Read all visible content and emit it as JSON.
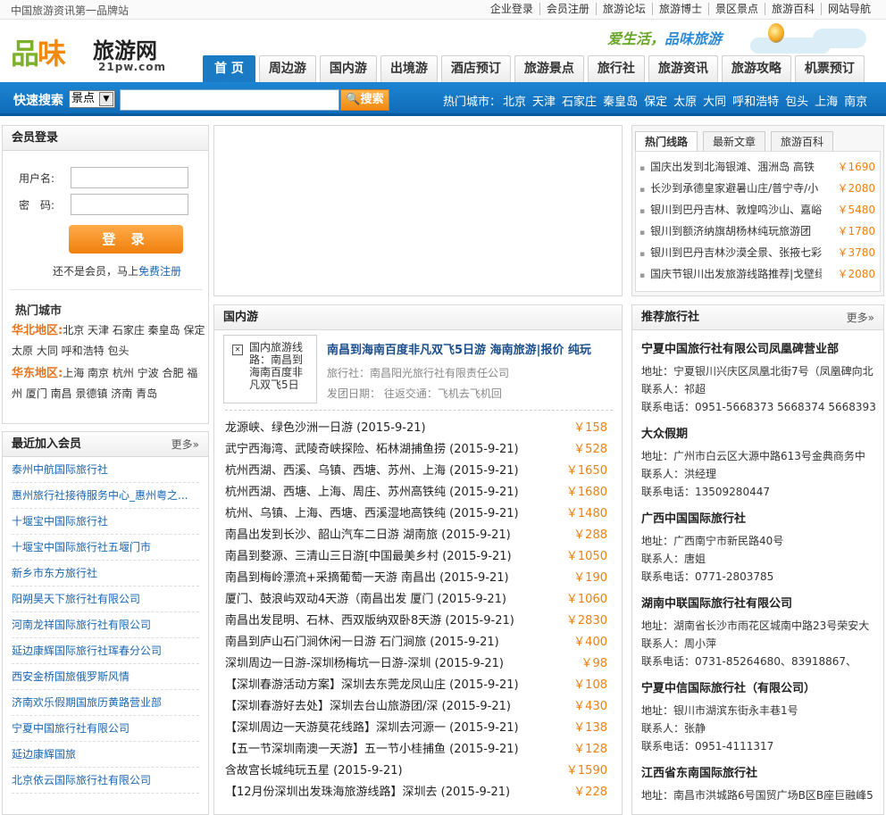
{
  "top": {
    "slogan": "中国旅游资讯第一品牌站",
    "links": [
      "企业登录",
      "会员注册",
      "旅游论坛",
      "旅游博士",
      "景区景点",
      "旅游百科",
      "网站导航"
    ]
  },
  "logo": {
    "pin": "品",
    "wei": "味",
    "name": "旅游网",
    "domain": "21pw.com"
  },
  "banner": {
    "text_a": "爱生活，",
    "text_b": "品味旅游"
  },
  "nav": {
    "tabs": [
      "首 页",
      "周边游",
      "国内游",
      "出境游",
      "酒店预订",
      "旅游景点",
      "旅行社",
      "旅游资讯",
      "旅游攻略",
      "机票预订"
    ]
  },
  "search": {
    "label": "快速搜索",
    "select_value": "景点",
    "button": "搜索",
    "hot_label": "热门城市：",
    "hot_cities": [
      "北京",
      "天津",
      "石家庄",
      "秦皇岛",
      "保定",
      "太原",
      "大同",
      "呼和浩特",
      "包头",
      "上海",
      "南京"
    ]
  },
  "login": {
    "title": "会员登录",
    "user_label": "用户名:",
    "pass_label": "密　码:",
    "button": "登 录",
    "reg_text": "还不是会员，马上",
    "reg_link": "免费注册"
  },
  "hotcity": {
    "title": "热门城市",
    "north_label": "华北地区:",
    "north": "北京 天津 石家庄 秦皇岛 保定 太原 大同 呼和浩特 包头",
    "east_label": "华东地区:",
    "east": "上海 南京 杭州 宁波 合肥 福州 厦门 南昌 景德镇 济南 青岛"
  },
  "members": {
    "title": "最近加入会员",
    "more": "更多»",
    "items": [
      "泰州中航国际旅行社",
      "惠州旅行社接待服务中心_惠州粤之...",
      "十堰宝中国际旅行社",
      "十堰宝中国际旅行社五堰门市",
      "新乡市东方旅行社",
      "阳朔昊天下旅行社有限公司",
      "河南龙祥国际旅行社有限公司",
      "延边康辉国际旅行社珲春分公司",
      "西安金桥国旅俄罗斯风情",
      "济南欢乐假期国旅历黄路营业部",
      "宁夏中国旅行社有限公司",
      "延边康辉国旅",
      "北京依云国际旅行社有限公司"
    ]
  },
  "domestic": {
    "title": "国内游",
    "feature_img_alt": "国内旅游线路：南昌到海南百度非凡双飞5日",
    "feature_title": "南昌到海南百度非凡双飞5日游 海南旅游|报价 纯玩",
    "agency_line": "旅行社：南昌阳光旅行社有限责任公司",
    "date_line": "发团日期：  往返交通：飞机去飞机回",
    "items": [
      {
        "t": "龙源峡、绿色沙洲一日游 (2015-9-21)",
        "p": "￥158"
      },
      {
        "t": "武宁西海湾、武陵奇峡探险、柘林湖捕鱼捞 (2015-9-21)",
        "p": "￥528"
      },
      {
        "t": "杭州西湖、西溪、乌镇、西塘、苏州、上海 (2015-9-21)",
        "p": "￥1650"
      },
      {
        "t": "杭州西湖、西塘、上海、周庄、苏州高铁纯 (2015-9-21)",
        "p": "￥1680"
      },
      {
        "t": "杭州、乌镇、上海、西塘、西溪湿地高铁纯 (2015-9-21)",
        "p": "￥1480"
      },
      {
        "t": "南昌出发到长沙、韶山汽车二日游 湖南旅 (2015-9-21)",
        "p": "￥288"
      },
      {
        "t": "南昌到婺源、三清山三日游[中国最美乡村 (2015-9-21)",
        "p": "￥1050"
      },
      {
        "t": "南昌到梅岭漂流+采摘葡萄一天游 南昌出 (2015-9-21)",
        "p": "￥190"
      },
      {
        "t": "厦门、鼓浪屿双动4天游（南昌出发 厦门 (2015-9-21)",
        "p": "￥1060"
      },
      {
        "t": "南昌出发昆明、石林、西双版纳双卧8天游 (2015-9-21)",
        "p": "￥2830"
      },
      {
        "t": "南昌到庐山石门涧休闲一日游 石门涧旅 (2015-9-21)",
        "p": "￥400"
      },
      {
        "t": "深圳周边一日游-深圳杨梅坑一日游-深圳 (2015-9-21)",
        "p": "￥98"
      },
      {
        "t": "【深圳春游活动方案】深圳去东莞龙凤山庄 (2015-9-21)",
        "p": "￥108"
      },
      {
        "t": "【深圳春游好去处】深圳去台山旅游团/深 (2015-9-21)",
        "p": "￥430"
      },
      {
        "t": "【深圳周边一天游莫花线路】深圳去河源一 (2015-9-21)",
        "p": "￥138"
      },
      {
        "t": "【五一节深圳南澳一天游】五一节小桂捕鱼 (2015-9-21)",
        "p": "￥128"
      },
      {
        "t": "含故宫长城纯玩五星 (2015-9-21)",
        "p": "￥1590"
      },
      {
        "t": "【12月份深圳出发珠海旅游线路】深圳去 (2015-9-21)",
        "p": "￥228"
      }
    ]
  },
  "hotroutes": {
    "tabs": [
      "热门线路",
      "最新文章",
      "旅游百科"
    ],
    "items": [
      {
        "t": "国庆出发到北海银滩、涠洲岛 高铁",
        "p": "￥1690"
      },
      {
        "t": "长沙到承德皇家避暑山庄/普宁寺/小",
        "p": "￥2080"
      },
      {
        "t": "银川到巴丹吉林、敦煌鸣沙山、嘉峪",
        "p": "￥5480"
      },
      {
        "t": "银川到额济纳旗胡杨林纯玩旅游团",
        "p": "￥1780"
      },
      {
        "t": "银川到巴丹吉林沙漠全景、张掖七彩",
        "p": "￥3780"
      },
      {
        "t": "国庆节银川出发旅游线路推荐|戈壁绿",
        "p": "￥2080"
      }
    ]
  },
  "agencies": {
    "title": "推荐旅行社",
    "more": "更多»",
    "items": [
      {
        "name": "宁夏中国旅行社有限公司凤凰碑营业部",
        "addr": "地址：宁夏银川兴庆区凤凰北街7号（凤凰碑向北",
        "contact": "联系人：祁超",
        "tel": "联系电话：0951-5668373 5668374 5668393"
      },
      {
        "name": "大众假期",
        "addr": "地址：广州市白云区大源中路613号金典商务中",
        "contact": "联系人：洪经理",
        "tel": "联系电话：13509280447"
      },
      {
        "name": "广西中国国际旅行社",
        "addr": "地址：广西南宁市新民路40号",
        "contact": "联系人：唐姐",
        "tel": "联系电话：0771-2803785"
      },
      {
        "name": "湖南中联国际旅行社有限公司",
        "addr": "地址：湖南省长沙市雨花区城南中路23号荣安大",
        "contact": "联系人：周小萍",
        "tel": "联系电话：0731-85264680、83918867、"
      },
      {
        "name": "宁夏中信国际旅行社（有限公司）",
        "addr": "地址：银川市湖滨东街永丰巷1号",
        "contact": "联系人：张静",
        "tel": "联系电话：0951-4111317"
      },
      {
        "name": "江西省东南国际旅行社",
        "addr": "地址：南昌市洪城路6号国贸广场B区B座巨融峰5",
        "contact": "",
        "tel": ""
      }
    ]
  }
}
